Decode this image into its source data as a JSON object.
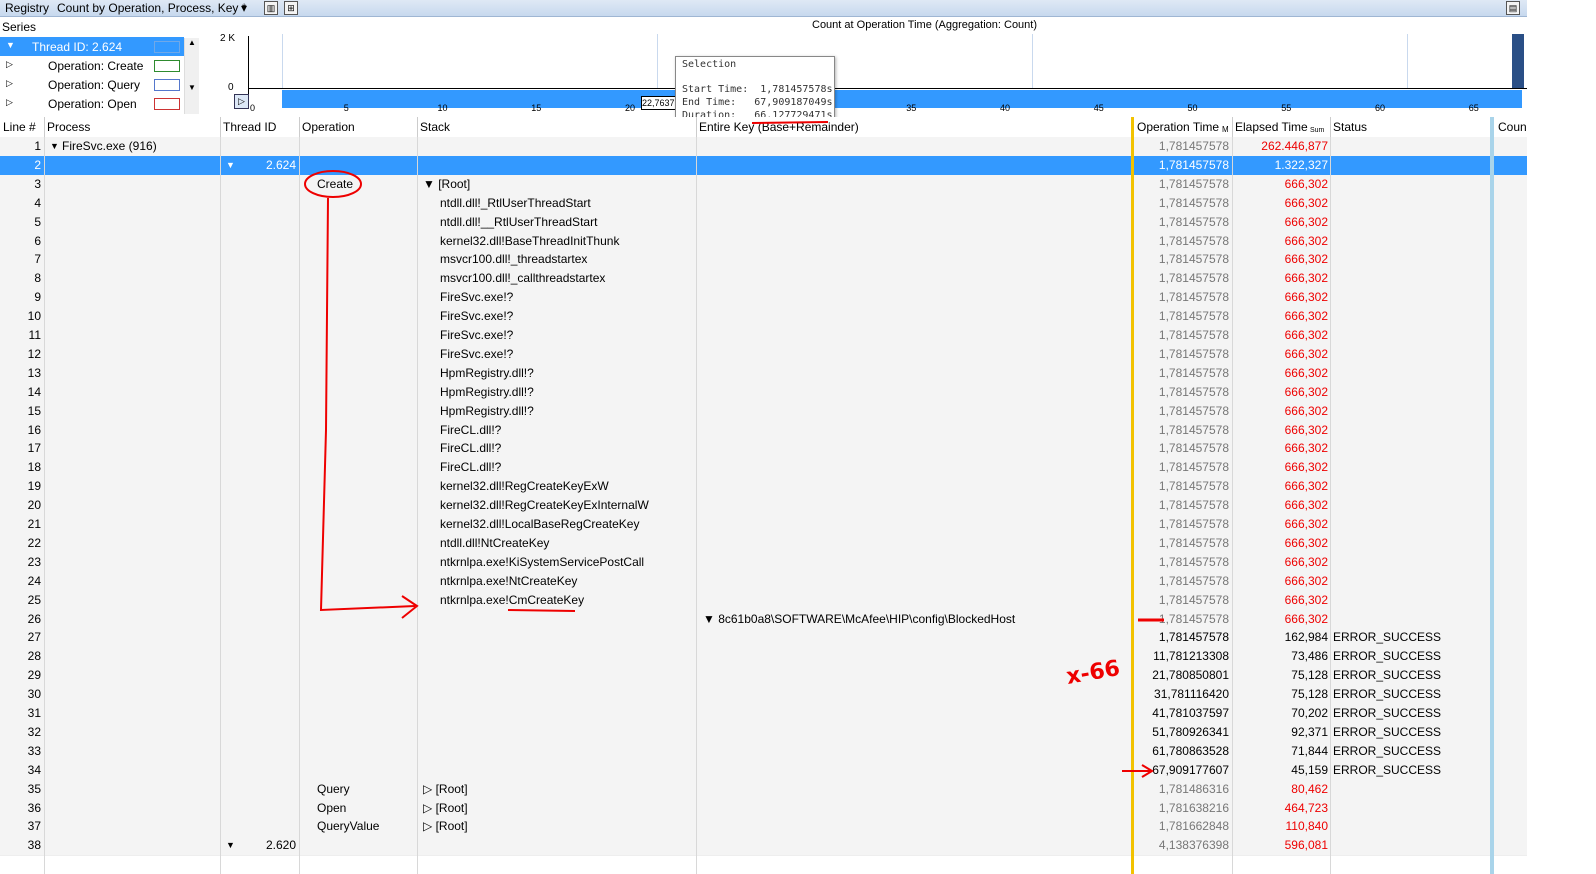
{
  "toolbar": {
    "title": "Registry",
    "view": "Count by Operation, Process, Key *",
    "dropdown_icon": "▾"
  },
  "series": {
    "header": "Series",
    "items": [
      {
        "label": "Thread ID: 2.624",
        "color": "#3399ff",
        "selected": true
      },
      {
        "label": "Operation: Create",
        "color": "#2e8b2e"
      },
      {
        "label": "Operation: Query",
        "color": "#5577cc"
      },
      {
        "label": "Operation: Open",
        "color": "#cc3333"
      }
    ]
  },
  "chart": {
    "title": "Count at Operation Time (Aggregation: Count)",
    "y_top": "2 K",
    "y_bottom": "0",
    "x_ticks": [
      "0",
      "5",
      "10",
      "15",
      "20",
      "25",
      "30",
      "35",
      "40",
      "45",
      "50",
      "55",
      "60",
      "65"
    ],
    "selection_value": "22,7637"
  },
  "chart_data": {
    "type": "bar",
    "title": "Count at Operation Time (Aggregation: Count)",
    "ylim": [
      0,
      2000
    ],
    "xlim": [
      0,
      67
    ]
  },
  "tooltip": {
    "title": "Selection",
    "start": "Start Time:  1,781457578s",
    "end": "End Time:   67,909187049s",
    "duration": "Duration:   66,127729471s"
  },
  "columns": [
    "Line #",
    "Process",
    "Thread ID",
    "Operation",
    "Stack",
    "Entire Key (Base+Remainder)",
    "Operation Time",
    "Elapsed Time",
    "Status",
    "Coun"
  ],
  "col_sub": {
    "op_time_sub": "M",
    "elapsed_sub": "Sum"
  },
  "rows": [
    {
      "line": "1",
      "process": "FireSvc.exe (916)",
      "thread": "",
      "op": "",
      "stack": "",
      "key": "",
      "optime": "1,781457578",
      "elapsed": "262.446,877",
      "status": "",
      "red": true
    },
    {
      "line": "2",
      "process": "",
      "thread": "2.624",
      "op": "",
      "stack": "",
      "key": "",
      "optime": "1,781457578",
      "elapsed": "1.322,327",
      "status": "",
      "red": true,
      "sel": true
    },
    {
      "line": "3",
      "process": "",
      "thread": "",
      "op": "Create",
      "stack": "▼ [Root]",
      "key": "",
      "optime": "1,781457578",
      "elapsed": "666,302",
      "status": "",
      "red": true
    },
    {
      "line": "4",
      "stack": "ntdll.dll!_RtlUserThreadStart",
      "optime": "1,781457578",
      "elapsed": "666,302",
      "red": true
    },
    {
      "line": "5",
      "stack": "ntdll.dll!__RtlUserThreadStart",
      "optime": "1,781457578",
      "elapsed": "666,302",
      "red": true
    },
    {
      "line": "6",
      "stack": "kernel32.dll!BaseThreadInitThunk",
      "optime": "1,781457578",
      "elapsed": "666,302",
      "red": true
    },
    {
      "line": "7",
      "stack": "msvcr100.dll!_threadstartex",
      "optime": "1,781457578",
      "elapsed": "666,302",
      "red": true
    },
    {
      "line": "8",
      "stack": "msvcr100.dll!_callthreadstartex",
      "optime": "1,781457578",
      "elapsed": "666,302",
      "red": true
    },
    {
      "line": "9",
      "stack": "FireSvc.exe!?",
      "optime": "1,781457578",
      "elapsed": "666,302",
      "red": true
    },
    {
      "line": "10",
      "stack": "FireSvc.exe!?",
      "optime": "1,781457578",
      "elapsed": "666,302",
      "red": true
    },
    {
      "line": "11",
      "stack": "FireSvc.exe!?",
      "optime": "1,781457578",
      "elapsed": "666,302",
      "red": true
    },
    {
      "line": "12",
      "stack": "FireSvc.exe!?",
      "optime": "1,781457578",
      "elapsed": "666,302",
      "red": true
    },
    {
      "line": "13",
      "stack": "HpmRegistry.dll!?",
      "optime": "1,781457578",
      "elapsed": "666,302",
      "red": true
    },
    {
      "line": "14",
      "stack": "HpmRegistry.dll!?",
      "optime": "1,781457578",
      "elapsed": "666,302",
      "red": true
    },
    {
      "line": "15",
      "stack": "HpmRegistry.dll!?",
      "optime": "1,781457578",
      "elapsed": "666,302",
      "red": true
    },
    {
      "line": "16",
      "stack": "FireCL.dll!?",
      "optime": "1,781457578",
      "elapsed": "666,302",
      "red": true
    },
    {
      "line": "17",
      "stack": "FireCL.dll!?",
      "optime": "1,781457578",
      "elapsed": "666,302",
      "red": true
    },
    {
      "line": "18",
      "stack": "FireCL.dll!?",
      "optime": "1,781457578",
      "elapsed": "666,302",
      "red": true
    },
    {
      "line": "19",
      "stack": "kernel32.dll!RegCreateKeyExW",
      "optime": "1,781457578",
      "elapsed": "666,302",
      "red": true
    },
    {
      "line": "20",
      "stack": "kernel32.dll!RegCreateKeyExInternalW",
      "optime": "1,781457578",
      "elapsed": "666,302",
      "red": true
    },
    {
      "line": "21",
      "stack": "kernel32.dll!LocalBaseRegCreateKey",
      "optime": "1,781457578",
      "elapsed": "666,302",
      "red": true
    },
    {
      "line": "22",
      "stack": "ntdll.dll!NtCreateKey",
      "optime": "1,781457578",
      "elapsed": "666,302",
      "red": true
    },
    {
      "line": "23",
      "stack": "ntkrnlpa.exe!KiSystemServicePostCall",
      "optime": "1,781457578",
      "elapsed": "666,302",
      "red": true
    },
    {
      "line": "24",
      "stack": "ntkrnlpa.exe!NtCreateKey",
      "optime": "1,781457578",
      "elapsed": "666,302",
      "red": true
    },
    {
      "line": "25",
      "stack": "ntkrnlpa.exe!CmCreateKey",
      "optime": "1,781457578",
      "elapsed": "666,302",
      "red": true
    },
    {
      "line": "26",
      "key": "▼ 8c61b0a8\\SOFTWARE\\McAfee\\HIP\\config\\BlockedHost",
      "optime": "1,781457578",
      "elapsed": "666,302",
      "red": true
    },
    {
      "line": "27",
      "optime": "1,781457578",
      "elapsed": "162,984",
      "status": "ERROR_SUCCESS",
      "dark": true
    },
    {
      "line": "28",
      "optime": "11,781213308",
      "elapsed": "73,486",
      "status": "ERROR_SUCCESS",
      "dark": true
    },
    {
      "line": "29",
      "optime": "21,780850801",
      "elapsed": "75,128",
      "status": "ERROR_SUCCESS",
      "dark": true
    },
    {
      "line": "30",
      "optime": "31,781116420",
      "elapsed": "75,128",
      "status": "ERROR_SUCCESS",
      "dark": true
    },
    {
      "line": "31",
      "optime": "41,781037597",
      "elapsed": "70,202",
      "status": "ERROR_SUCCESS",
      "dark": true
    },
    {
      "line": "32",
      "optime": "51,780926341",
      "elapsed": "92,371",
      "status": "ERROR_SUCCESS",
      "dark": true
    },
    {
      "line": "33",
      "optime": "61,780863528",
      "elapsed": "71,844",
      "status": "ERROR_SUCCESS",
      "dark": true
    },
    {
      "line": "34",
      "optime": "67,909177607",
      "elapsed": "45,159",
      "status": "ERROR_SUCCESS",
      "dark": true
    },
    {
      "line": "35",
      "op": "Query",
      "stack": "▷ [Root]",
      "optime": "1,781486316",
      "elapsed": "80,462",
      "red": true
    },
    {
      "line": "36",
      "op": "Open",
      "stack": "▷ [Root]",
      "optime": "1,781638216",
      "elapsed": "464,723",
      "red": true
    },
    {
      "line": "37",
      "op": "QueryValue",
      "stack": "▷ [Root]",
      "optime": "1,781662848",
      "elapsed": "110,840",
      "red": true
    },
    {
      "line": "38",
      "thread": "2.620",
      "optime": "4,138376398",
      "elapsed": "596,081",
      "red": true
    }
  ],
  "annotation": {
    "handwritten": "x-66"
  }
}
